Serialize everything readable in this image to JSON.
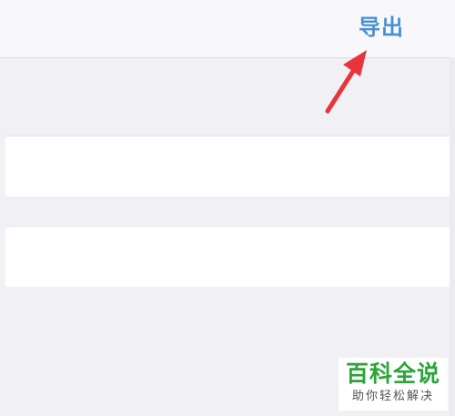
{
  "nav": {
    "export_label": "导出"
  },
  "colors": {
    "accent": "#4a8fd2",
    "arrow": "#e8343a",
    "watermark": "#2aa53a"
  },
  "watermark": {
    "title": "百科全说",
    "subtitle": "助你轻松解决"
  }
}
